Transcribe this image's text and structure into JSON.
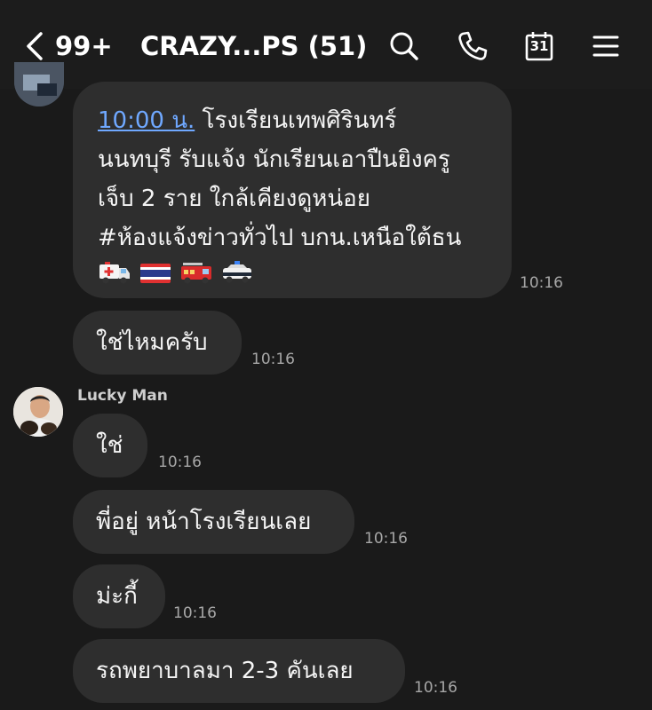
{
  "header": {
    "unread_count": "99+",
    "chat_title": "CRAZY...PS (51)",
    "calendar_day": "31",
    "icons": [
      "chevron-left-icon",
      "search-icon",
      "phone-icon",
      "calendar-icon",
      "menu-icon"
    ]
  },
  "messages": [
    {
      "link_time": "10:00 น.",
      "text_line1": " โรงเรียนเทพศิรินทร์",
      "text_line2": "นนทบุรี  รับแจ้ง นักเรียนเอาปืนยิงครู",
      "text_line3": "เจ็บ 2 ราย ใกล้เคียงดูหน่อย",
      "text_line4": "#ห้องแจ้งข่าวทั่วไป บกน.เหนือใต้ธน",
      "emojis": [
        "ambulance",
        "thailand-flag",
        "fire-engine",
        "police-car"
      ],
      "time": "10:16"
    },
    {
      "text": "ใช่ไหมครับ",
      "time": "10:16"
    },
    {
      "sender": "Lucky Man",
      "text": "ใช่",
      "time": "10:16"
    },
    {
      "text": "พี่อยู่ หน้าโรงเรียนเลย",
      "time": "10:16"
    },
    {
      "text": "ม่ะกี้",
      "time": "10:16"
    },
    {
      "text": "รถพยาบาลมา 2-3 คันเลย",
      "time": "10:16"
    }
  ],
  "colors": {
    "background": "#1a1a1a",
    "bubble": "#2e2e2e",
    "link": "#6fa8ff",
    "timestamp": "#a7a7a7"
  }
}
